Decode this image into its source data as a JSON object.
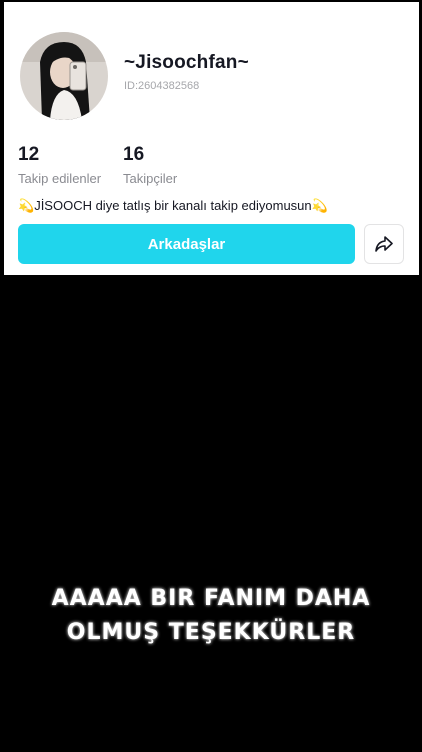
{
  "profile": {
    "username": "~Jisoochfan~",
    "id_text": "ID:2604382568",
    "following_count": "12",
    "following_label": "Takip edilenler",
    "followers_count": "16",
    "followers_label": "Takipçiler",
    "bio_text": "JİSOOCH diye tatlış bir kanalı takip ediyomusun",
    "bio_emoji_icon": "dizzy-sparkle-icon"
  },
  "actions": {
    "friends_label": "Arkadaşlar",
    "share_icon": "share-arrow-icon"
  },
  "overlay": {
    "caption_line1": "AAAAA BIR FANIM DAHA",
    "caption_line2": "OLMUŞ TEŞEKKÜRLER"
  },
  "colors": {
    "button_bg": "#20d5ec",
    "background": "#000000",
    "card": "#ffffff"
  }
}
